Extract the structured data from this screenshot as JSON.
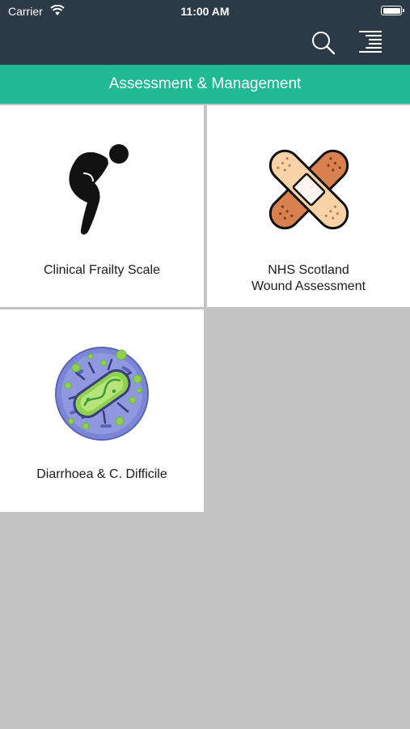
{
  "status_bar": {
    "carrier": "Carrier",
    "time": "11:00 AM"
  },
  "nav": {
    "search_icon": "search-icon",
    "menu_icon": "menu-lines-icon"
  },
  "header": {
    "title": "Assessment & Management"
  },
  "colors": {
    "nav_bg": "#2c3a47",
    "accent": "#1fb994",
    "page_bg": "#c4c4c4"
  },
  "tiles": [
    {
      "label": "Clinical Frailty Scale",
      "icon": "stooped-person-icon"
    },
    {
      "label": "NHS Scotland\nWound Assessment",
      "icon": "plaster-bandage-icon"
    },
    {
      "label": "Diarrhoea & C. Difficile",
      "icon": "bacteria-icon"
    }
  ]
}
